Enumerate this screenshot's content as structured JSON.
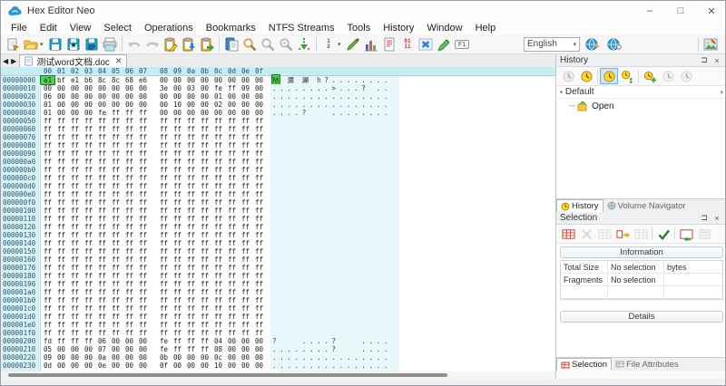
{
  "window": {
    "title": "Hex Editor Neo",
    "minimize": "–",
    "maximize": "□",
    "close": "✕"
  },
  "menu": [
    "File",
    "Edit",
    "View",
    "Select",
    "Operations",
    "Bookmarks",
    "NTFS Streams",
    "Tools",
    "History",
    "Window",
    "Help"
  ],
  "toolbar": {
    "items": [
      {
        "name": "new-file"
      },
      {
        "name": "open-file",
        "caret": true
      },
      {
        "name": "save"
      },
      {
        "name": "save-all"
      },
      {
        "name": "save-as"
      },
      {
        "name": "print"
      },
      {
        "name": "sep"
      },
      {
        "name": "undo",
        "disabled": true
      },
      {
        "name": "redo",
        "disabled": true
      },
      {
        "name": "clipboard-edit"
      },
      {
        "name": "clipboard-paste"
      },
      {
        "name": "clipboard-copy"
      },
      {
        "name": "sep"
      },
      {
        "name": "paste-special"
      },
      {
        "name": "find"
      },
      {
        "name": "find-next",
        "disabled": true
      },
      {
        "name": "find-all",
        "disabled": true
      },
      {
        "name": "goto-offset"
      },
      {
        "name": "sep"
      },
      {
        "name": "numbered-list",
        "label": "1\n2",
        "caret": true
      },
      {
        "name": "fill-tool"
      },
      {
        "name": "statistics"
      },
      {
        "name": "report"
      },
      {
        "name": "binary-view",
        "label": "01\n11"
      },
      {
        "name": "fit-window"
      },
      {
        "name": "highlighter"
      },
      {
        "name": "help-f1",
        "label": "F1"
      }
    ],
    "language": {
      "value": "English"
    },
    "after_language": [
      {
        "name": "add-language-globe"
      },
      {
        "name": "language-web-globe"
      }
    ],
    "right": [
      {
        "name": "structure-viewer"
      }
    ]
  },
  "tabstrip": {
    "nav_left": "◀",
    "nav_right": "▶",
    "tab": {
      "label": "测试word文档.doc",
      "close": "✕"
    }
  },
  "hex": {
    "col_headers": [
      "00",
      "01",
      "02",
      "03",
      "04",
      "05",
      "06",
      "07",
      "08",
      "09",
      "0a",
      "0b",
      "0c",
      "0d",
      "0e",
      "0f"
    ],
    "selection": {
      "row": 0,
      "cell": 0
    },
    "rows": [
      {
        "a": "00000000",
        "h": "a1 bf e1 b6 8c 8c 68 e6 00 00 00 00 00 00 00 00",
        "t": "毡 瀰 灦 h?........"
      },
      {
        "a": "00000010",
        "h": "00 00 00 00 00 00 00 00 3e 00 03 00 fe ff 09 00",
        "t": "........>...? .."
      },
      {
        "a": "00000020",
        "h": "06 00 00 00 00 00 00 00 00 00 00 00 01 00 00 00",
        "t": "................"
      },
      {
        "a": "00000030",
        "h": "01 00 00 00 00 00 00 00 00 10 00 00 02 00 00 00",
        "t": "................"
      },
      {
        "a": "00000040",
        "h": "01 00 00 00 fe ff ff ff 00 00 00 00 00 00 00 00",
        "t": "....?   ........"
      },
      {
        "a": "00000050",
        "h": "ff ff ff ff ff ff ff ff ff ff ff ff ff ff ff ff",
        "t": ""
      },
      {
        "a": "00000060",
        "h": "ff ff ff ff ff ff ff ff ff ff ff ff ff ff ff ff",
        "t": ""
      },
      {
        "a": "00000070",
        "h": "ff ff ff ff ff ff ff ff ff ff ff ff ff ff ff ff",
        "t": ""
      },
      {
        "a": "00000080",
        "h": "ff ff ff ff ff ff ff ff ff ff ff ff ff ff ff ff",
        "t": ""
      },
      {
        "a": "00000090",
        "h": "ff ff ff ff ff ff ff ff ff ff ff ff ff ff ff ff",
        "t": ""
      },
      {
        "a": "000000a0",
        "h": "ff ff ff ff ff ff ff ff ff ff ff ff ff ff ff ff",
        "t": ""
      },
      {
        "a": "000000b0",
        "h": "ff ff ff ff ff ff ff ff ff ff ff ff ff ff ff ff",
        "t": ""
      },
      {
        "a": "000000c0",
        "h": "ff ff ff ff ff ff ff ff ff ff ff ff ff ff ff ff",
        "t": ""
      },
      {
        "a": "000000d0",
        "h": "ff ff ff ff ff ff ff ff ff ff ff ff ff ff ff ff",
        "t": ""
      },
      {
        "a": "000000e0",
        "h": "ff ff ff ff ff ff ff ff ff ff ff ff ff ff ff ff",
        "t": ""
      },
      {
        "a": "000000f0",
        "h": "ff ff ff ff ff ff ff ff ff ff ff ff ff ff ff ff",
        "t": ""
      },
      {
        "a": "00000100",
        "h": "ff ff ff ff ff ff ff ff ff ff ff ff ff ff ff ff",
        "t": ""
      },
      {
        "a": "00000110",
        "h": "ff ff ff ff ff ff ff ff ff ff ff ff ff ff ff ff",
        "t": ""
      },
      {
        "a": "00000120",
        "h": "ff ff ff ff ff ff ff ff ff ff ff ff ff ff ff ff",
        "t": ""
      },
      {
        "a": "00000130",
        "h": "ff ff ff ff ff ff ff ff ff ff ff ff ff ff ff ff",
        "t": ""
      },
      {
        "a": "00000140",
        "h": "ff ff ff ff ff ff ff ff ff ff ff ff ff ff ff ff",
        "t": ""
      },
      {
        "a": "00000150",
        "h": "ff ff ff ff ff ff ff ff ff ff ff ff ff ff ff ff",
        "t": ""
      },
      {
        "a": "00000160",
        "h": "ff ff ff ff ff ff ff ff ff ff ff ff ff ff ff ff",
        "t": ""
      },
      {
        "a": "00000170",
        "h": "ff ff ff ff ff ff ff ff ff ff ff ff ff ff ff ff",
        "t": ""
      },
      {
        "a": "00000180",
        "h": "ff ff ff ff ff ff ff ff ff ff ff ff ff ff ff ff",
        "t": ""
      },
      {
        "a": "00000190",
        "h": "ff ff ff ff ff ff ff ff ff ff ff ff ff ff ff ff",
        "t": ""
      },
      {
        "a": "000001a0",
        "h": "ff ff ff ff ff ff ff ff ff ff ff ff ff ff ff ff",
        "t": ""
      },
      {
        "a": "000001b0",
        "h": "ff ff ff ff ff ff ff ff ff ff ff ff ff ff ff ff",
        "t": ""
      },
      {
        "a": "000001c0",
        "h": "ff ff ff ff ff ff ff ff ff ff ff ff ff ff ff ff",
        "t": ""
      },
      {
        "a": "000001d0",
        "h": "ff ff ff ff ff ff ff ff ff ff ff ff ff ff ff ff",
        "t": ""
      },
      {
        "a": "000001e0",
        "h": "ff ff ff ff ff ff ff ff ff ff ff ff ff ff ff ff",
        "t": ""
      },
      {
        "a": "000001f0",
        "h": "ff ff ff ff ff ff ff ff ff ff ff ff ff ff ff ff",
        "t": ""
      },
      {
        "a": "00000200",
        "h": "fd ff ff ff 06 00 00 00 fe ff ff ff 04 00 00 00",
        "t": "?   ....?   ...."
      },
      {
        "a": "00000210",
        "h": "05 00 00 00 07 00 00 00 fe ff ff ff 08 00 00 00",
        "t": "........?   ...."
      },
      {
        "a": "00000220",
        "h": "09 00 00 00 0a 00 00 00 0b 00 00 00 0c 00 00 00",
        "t": "................"
      },
      {
        "a": "00000230",
        "h": "0d 00 00 00 0e 00 00 00 0f 00 00 00 10 00 00 00",
        "t": "................"
      }
    ]
  },
  "history_panel": {
    "title": "History",
    "pin": "⊐",
    "close": "×",
    "tools": [
      {
        "name": "history-back",
        "disabled": true
      },
      {
        "name": "history-save"
      },
      {
        "name": "history-branches",
        "selected": true
      },
      {
        "name": "history-timeline"
      },
      {
        "name": "history-add"
      },
      {
        "name": "history-clear",
        "disabled": true
      },
      {
        "name": "history-settings",
        "disabled": true
      }
    ],
    "group": "Default",
    "tree": [
      {
        "label": "Open"
      }
    ],
    "tabs": [
      {
        "label": "History",
        "active": true
      },
      {
        "label": "Volume Navigator",
        "active": false
      }
    ]
  },
  "selection_panel": {
    "title": "Selection",
    "pin": "⊐",
    "close": "×",
    "tools": [
      {
        "name": "select-all"
      },
      {
        "name": "deselect",
        "disabled": true
      },
      {
        "name": "invert-selection",
        "disabled": true
      },
      {
        "name": "move-selection"
      },
      {
        "name": "resize-selection",
        "disabled": true
      },
      {
        "name": "validate-selection"
      },
      {
        "name": "load-selection"
      },
      {
        "name": "save-selection",
        "disabled": true
      }
    ],
    "info_header": "Information",
    "table": [
      [
        "Total Size",
        "No selection",
        "bytes"
      ],
      [
        "Fragments",
        "No selection",
        ""
      ]
    ],
    "details_button": "Details",
    "tabs": [
      {
        "label": "Selection",
        "active": true
      },
      {
        "label": "File Attributes",
        "active": false
      }
    ]
  }
}
